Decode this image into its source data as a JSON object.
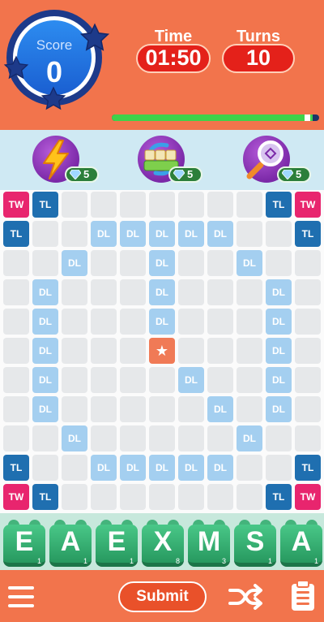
{
  "header": {
    "score": {
      "label": "Score",
      "value": "0",
      "stars_earned": 0,
      "stars_total": 3
    },
    "time": {
      "label": "Time",
      "value": "01:50"
    },
    "turns": {
      "label": "Turns",
      "value": "10"
    },
    "progress_fraction": 0.97
  },
  "powerups": [
    {
      "icon": "lightning-icon",
      "gems": "5"
    },
    {
      "icon": "swap-tiles-icon",
      "gems": "5"
    },
    {
      "icon": "magnifier-icon",
      "gems": "5"
    }
  ],
  "board": {
    "rows": [
      [
        "TW",
        "TL",
        "",
        "",
        "",
        "",
        "",
        "",
        "",
        "TL",
        "TW"
      ],
      [
        "TL",
        "",
        "",
        "DL",
        "DL",
        "DL",
        "DL",
        "DL",
        "",
        "",
        "TL"
      ],
      [
        "",
        "",
        "DL",
        "",
        "",
        "DL",
        "",
        "",
        "DL",
        "",
        ""
      ],
      [
        "",
        "DL",
        "",
        "",
        "",
        "DL",
        "",
        "",
        "",
        "DL",
        ""
      ],
      [
        "",
        "DL",
        "",
        "",
        "",
        "DL",
        "",
        "",
        "",
        "DL",
        ""
      ],
      [
        "",
        "DL",
        "",
        "",
        "",
        "★",
        "",
        "",
        "",
        "DL",
        ""
      ],
      [
        "",
        "DL",
        "",
        "",
        "",
        "",
        "DL",
        "",
        "",
        "DL",
        ""
      ],
      [
        "",
        "DL",
        "",
        "",
        "",
        "",
        "",
        "DL",
        "",
        "DL",
        ""
      ],
      [
        "",
        "",
        "DL",
        "",
        "",
        "",
        "",
        "",
        "DL",
        "",
        ""
      ],
      [
        "TL",
        "",
        "",
        "DL",
        "DL",
        "DL",
        "DL",
        "DL",
        "",
        "",
        "TL"
      ],
      [
        "TW",
        "TL",
        "",
        "",
        "",
        "",
        "",
        "",
        "",
        "TL",
        "TW"
      ]
    ]
  },
  "rack": [
    {
      "letter": "E",
      "points": "1"
    },
    {
      "letter": "A",
      "points": "1"
    },
    {
      "letter": "E",
      "points": "1"
    },
    {
      "letter": "X",
      "points": "8"
    },
    {
      "letter": "M",
      "points": "3"
    },
    {
      "letter": "S",
      "points": "1"
    },
    {
      "letter": "A",
      "points": "1"
    }
  ],
  "footer": {
    "submit_label": "Submit",
    "menu_icon": "hamburger-menu-icon",
    "shuffle_icon": "shuffle-icon",
    "clipboard_icon": "clipboard-icon"
  },
  "colors": {
    "header_bg": "#f2744c",
    "timer_pill": "#e4211a",
    "powerbar_bg": "#cfe9f3",
    "triple_word": "#e8256e",
    "triple_letter": "#1f6fb0",
    "double_letter": "#a4cff0",
    "center": "#f07a56",
    "tile_green": "#39b374",
    "rack_bg": "#c7e8dc"
  }
}
